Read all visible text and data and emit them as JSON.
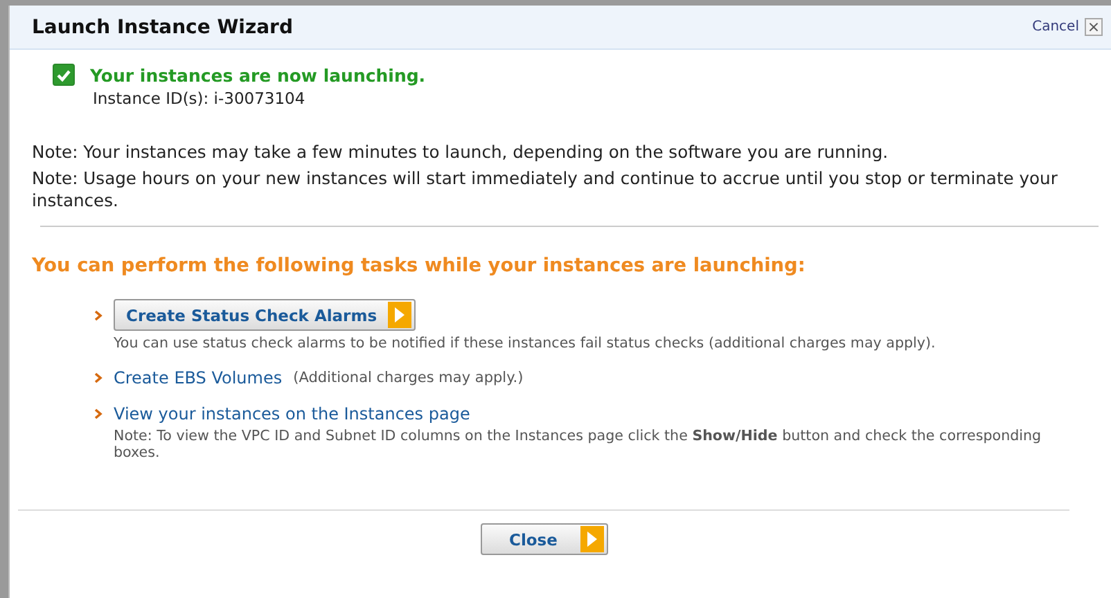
{
  "window": {
    "title": "Launch Instance Wizard",
    "cancel": "Cancel",
    "close_glyph": "×"
  },
  "status": {
    "checked": true,
    "message": "Your instances are now launching.",
    "instance_ids": "Instance ID(s): i-30073104"
  },
  "notes": [
    "Note: Your instances may take a few minutes to launch, depending on the software you are running.",
    "Note: Usage hours on your new instances will start immediately and continue to accrue until you stop or terminate your instances."
  ],
  "tasks_heading": "You can perform the following tasks while your instances are launching:",
  "tasks": [
    {
      "kind": "button",
      "label": "Create Status Check Alarms",
      "note": "You can use status check alarms to be notified if these instances fail status checks (additional charges may apply)."
    },
    {
      "kind": "link",
      "label": "Create EBS Volumes",
      "aside": "(Additional charges may apply.)"
    },
    {
      "kind": "link",
      "label": "View your instances on the Instances page",
      "note": "Note: To view the VPC ID and Subnet ID columns on the Instances page click the **Show/Hide** button and check the corresponding boxes."
    }
  ],
  "footer_button": "Close"
}
